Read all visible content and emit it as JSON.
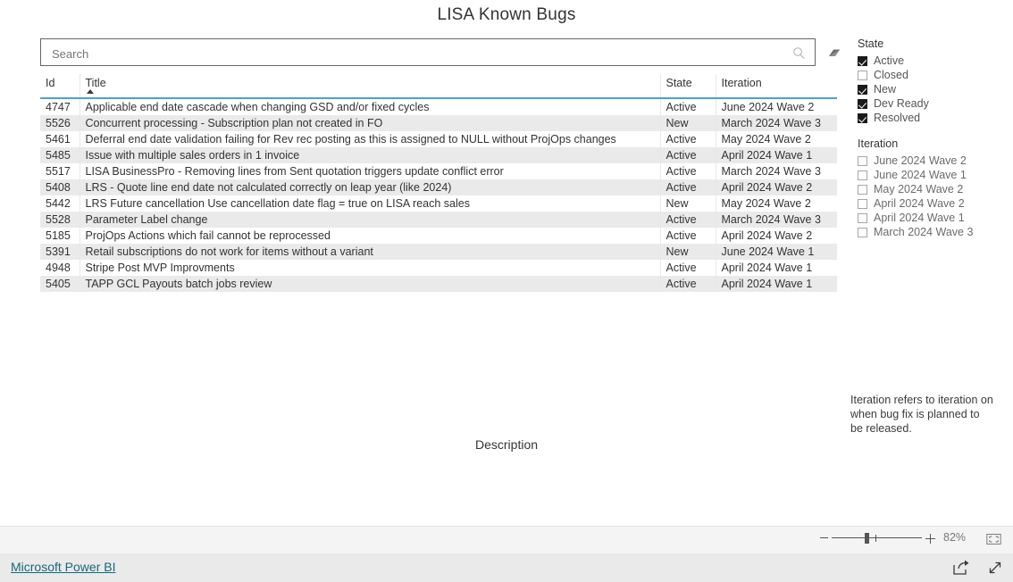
{
  "report": {
    "title": "LISA Known Bugs",
    "description_label": "Description",
    "note": "Iteration refers to iteration on when bug fix is planned to be released."
  },
  "search": {
    "placeholder": "Search",
    "value": "",
    "search_icon": "search-icon",
    "clear_icon": "eraser-icon"
  },
  "table": {
    "columns": [
      {
        "key": "id",
        "label": "Id"
      },
      {
        "key": "title",
        "label": "Title",
        "sort": "asc"
      },
      {
        "key": "state",
        "label": "State"
      },
      {
        "key": "iteration",
        "label": "Iteration"
      }
    ],
    "rows": [
      {
        "id": "4747",
        "title": "Applicable end date cascade when changing GSD and/or fixed cycles",
        "state": "Active",
        "iteration": "June 2024 Wave 2"
      },
      {
        "id": "5526",
        "title": "Concurrent processing - Subscription plan not created in FO",
        "state": "New",
        "iteration": "March 2024 Wave 3"
      },
      {
        "id": "5461",
        "title": "Deferral end date validation failing for Rev rec posting as this is assigned to NULL without ProjOps changes",
        "state": "Active",
        "iteration": "May 2024 Wave 2"
      },
      {
        "id": "5485",
        "title": "Issue with multiple sales orders in 1 invoice",
        "state": "Active",
        "iteration": "April 2024 Wave 1"
      },
      {
        "id": "5517",
        "title": "LISA BusinessPro - Removing lines from Sent quotation triggers update conflict error",
        "state": "Active",
        "iteration": "March 2024 Wave 3"
      },
      {
        "id": "5408",
        "title": "LRS - Quote line end date not calculated correctly on leap year (like 2024)",
        "state": "Active",
        "iteration": "April 2024 Wave 2"
      },
      {
        "id": "5442",
        "title": "LRS Future cancellation Use cancellation date flag = true on LISA reach sales",
        "state": "New",
        "iteration": "May 2024 Wave 2"
      },
      {
        "id": "5528",
        "title": "Parameter Label change",
        "state": "Active",
        "iteration": "March 2024 Wave 3"
      },
      {
        "id": "5185",
        "title": "ProjOps Actions which fail cannot be reprocessed",
        "state": "Active",
        "iteration": "April 2024 Wave 2"
      },
      {
        "id": "5391",
        "title": "Retail subscriptions do not work for items without a variant",
        "state": "New",
        "iteration": "June 2024 Wave 1"
      },
      {
        "id": "4948",
        "title": "Stripe Post MVP Improvments",
        "state": "Active",
        "iteration": "April 2024 Wave 1"
      },
      {
        "id": "5405",
        "title": "TAPP GCL Payouts batch jobs review",
        "state": "Active",
        "iteration": "April 2024 Wave 1"
      }
    ]
  },
  "filters": {
    "state": {
      "title": "State",
      "items": [
        {
          "label": "Active",
          "checked": true
        },
        {
          "label": "Closed",
          "checked": false
        },
        {
          "label": "New",
          "checked": true
        },
        {
          "label": "Dev Ready",
          "checked": true
        },
        {
          "label": "Resolved",
          "checked": true
        }
      ]
    },
    "iteration": {
      "title": "Iteration",
      "items": [
        {
          "label": "June 2024 Wave 2",
          "checked": false
        },
        {
          "label": "June 2024 Wave 1",
          "checked": false
        },
        {
          "label": "May 2024 Wave 2",
          "checked": false
        },
        {
          "label": "April 2024 Wave 2",
          "checked": false
        },
        {
          "label": "April 2024 Wave 1",
          "checked": false
        },
        {
          "label": "March 2024 Wave 3",
          "checked": false
        }
      ]
    }
  },
  "statusbar": {
    "zoom_out_label": "-",
    "zoom_in_label": "+",
    "zoom_level": "82%",
    "fit_icon": "fit-to-screen-icon"
  },
  "footer": {
    "brand": "Microsoft Power BI",
    "share_icon": "share-icon",
    "fullscreen_icon": "expand-icon"
  },
  "colors": {
    "header_underline": "#4a9fe0",
    "row_alt": "#eaeaea",
    "brand_link": "#15697b",
    "checkbox_on": "#1a1a1a"
  }
}
